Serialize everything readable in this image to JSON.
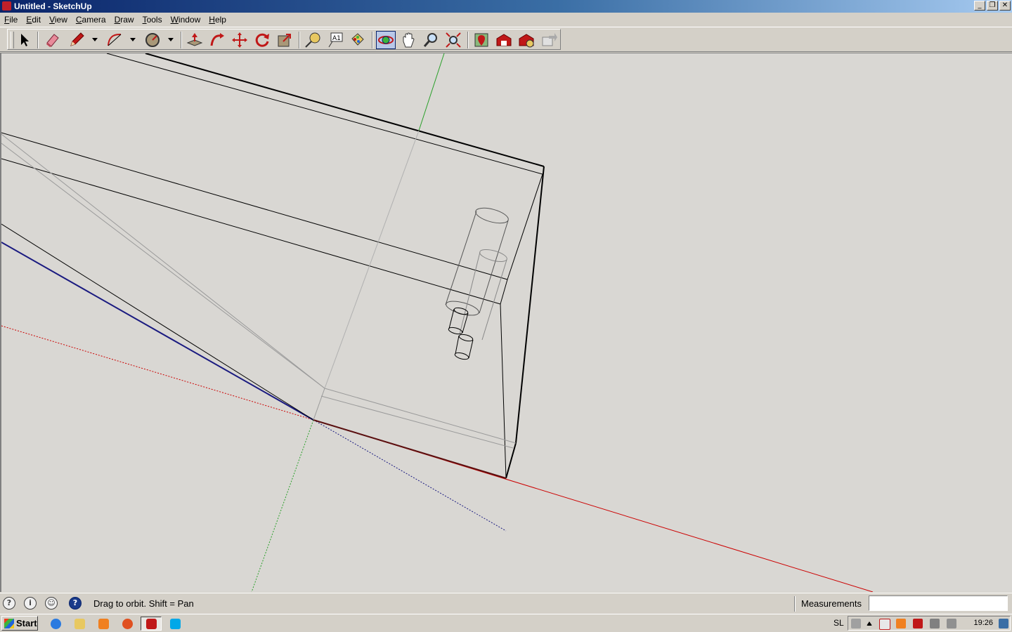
{
  "window": {
    "title": "Untitled - SketchUp",
    "controls": [
      "minimize",
      "restore",
      "close"
    ]
  },
  "menu": [
    "File",
    "Edit",
    "View",
    "Camera",
    "Draw",
    "Tools",
    "Window",
    "Help"
  ],
  "toolbar": {
    "tools": [
      {
        "name": "select-tool-icon",
        "label": "Select"
      },
      {
        "name": "eraser-tool-icon",
        "label": "Eraser"
      },
      {
        "name": "pencil-tool-icon",
        "label": "Line"
      },
      {
        "name": "arc-tool-icon",
        "label": "Arc"
      },
      {
        "name": "circle-tool-icon",
        "label": "Circle"
      },
      {
        "name": "push-pull-tool-icon",
        "label": "Push/Pull"
      },
      {
        "name": "follow-me-tool-icon",
        "label": "Follow Me"
      },
      {
        "name": "move-tool-icon",
        "label": "Move"
      },
      {
        "name": "rotate-tool-icon",
        "label": "Rotate"
      },
      {
        "name": "scale-tool-icon",
        "label": "Scale"
      },
      {
        "name": "tape-measure-tool-icon",
        "label": "Tape Measure"
      },
      {
        "name": "text-tool-icon",
        "label": "Text",
        "glyph": "A1"
      },
      {
        "name": "paint-bucket-tool-icon",
        "label": "Paint Bucket"
      },
      {
        "name": "orbit-tool-icon",
        "label": "Orbit",
        "active": true
      },
      {
        "name": "pan-tool-icon",
        "label": "Pan"
      },
      {
        "name": "zoom-tool-icon",
        "label": "Zoom"
      },
      {
        "name": "zoom-extents-tool-icon",
        "label": "Zoom Extents"
      },
      {
        "name": "add-location-icon",
        "label": "Add Location"
      },
      {
        "name": "warehouse-icon",
        "label": "3D Warehouse"
      },
      {
        "name": "extension-warehouse-icon",
        "label": "Extension Warehouse"
      },
      {
        "name": "share-model-icon",
        "label": "Share Model"
      }
    ]
  },
  "axes_colors": {
    "red": "#cc0000",
    "green": "#00a000",
    "blue": "#000080"
  },
  "status": {
    "hint": "Drag to orbit.  Shift = Pan",
    "measurements_label": "Measurements",
    "measurements_value": ""
  },
  "taskbar": {
    "start_label": "Start",
    "apps": [
      "internet-explorer-icon",
      "file-explorer-icon",
      "media-player-icon",
      "firefox-icon",
      "sketchup-icon",
      "skype-icon"
    ],
    "language": "SL",
    "clock": "19:26"
  }
}
